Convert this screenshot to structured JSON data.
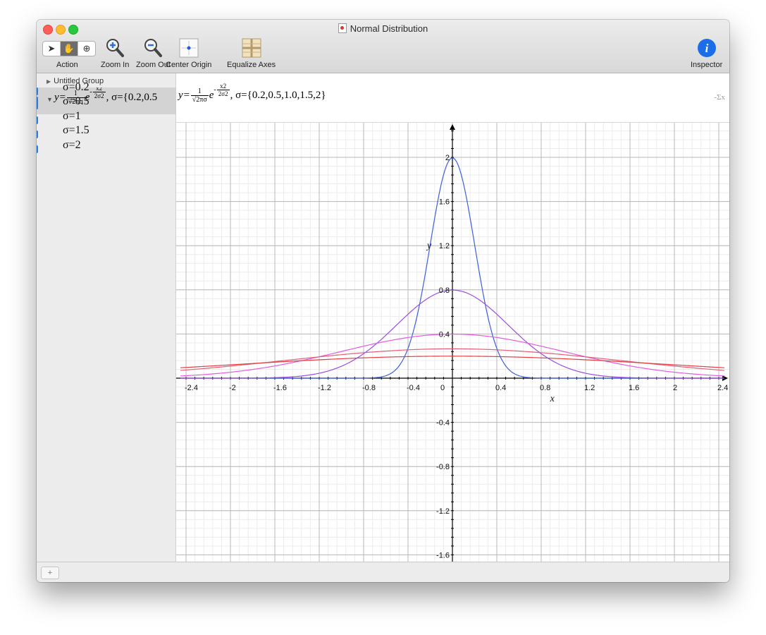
{
  "window": {
    "title": "Normal Distribution"
  },
  "toolbar": {
    "action_label": "Action",
    "zoom_in_label": "Zoom In",
    "zoom_out_label": "Zoom Out",
    "center_origin_label": "Center Origin",
    "equalize_axes_label": "Equalize Axes",
    "inspector_label": "Inspector"
  },
  "sidebar": {
    "group_label": "Untitled Group",
    "equation": {
      "lhs": "y=",
      "frac_num": "1",
      "frac_den": "√2πσ",
      "exp_base": "e",
      "exp_sign": "-",
      "exp_num": "x2",
      "exp_den": "2σ2",
      "params": ", σ={0.2,0.5"
    },
    "items": [
      {
        "label": "σ=0.2"
      },
      {
        "label": "σ=0.5"
      },
      {
        "label": "σ=1"
      },
      {
        "label": "σ=1.5"
      },
      {
        "label": "σ=2"
      }
    ]
  },
  "header_equation": {
    "lhs": "y=",
    "frac_num": "1",
    "frac_den": "√2πσ",
    "exp_base": "e",
    "exp_sign": "-",
    "exp_num": "x2",
    "exp_den": "2σ2",
    "params": ", σ={0.2,0.5,1.0,1.5,2}"
  },
  "colors": {
    "sigma_0_2": "#3b5fe0",
    "sigma_0_5": "#9b4fe0",
    "sigma_1": "#e35ce0",
    "sigma_1_5": "#e0607a",
    "sigma_2": "#e04040"
  },
  "chart_data": {
    "type": "line",
    "xlabel": "x",
    "ylabel": "y",
    "xlim": [
      -2.45,
      2.45
    ],
    "ylim": [
      -1.62,
      2.3
    ],
    "x_ticks": [
      -2.4,
      -2,
      -1.6,
      -1.2,
      -0.8,
      -0.4,
      0,
      0.4,
      0.8,
      1.2,
      1.6,
      2,
      2.4
    ],
    "y_ticks": [
      2,
      1.6,
      1.2,
      0.8,
      0.4,
      -0.4,
      -0.8,
      -1.2,
      -1.6
    ],
    "x_tick_labels": [
      "-2.4",
      "-2",
      "-1.6",
      "-1.2",
      "-0.8",
      "-0.4",
      "0",
      "0.4",
      "0.8",
      "1.2",
      "1.6",
      "2",
      "2.4"
    ],
    "y_tick_labels": [
      "2",
      "1.6",
      "1.2",
      "0.8",
      "0.4",
      "-0.4",
      "-0.8",
      "-1.2",
      "-1.6"
    ],
    "grid": true,
    "series": [
      {
        "name": "σ=0.2",
        "sigma": 0.2,
        "color": "#3b5fe0"
      },
      {
        "name": "σ=0.5",
        "sigma": 0.5,
        "color": "#9b4fe0"
      },
      {
        "name": "σ=1",
        "sigma": 1.0,
        "color": "#e35ce0"
      },
      {
        "name": "σ=1.5",
        "sigma": 1.5,
        "color": "#e0607a"
      },
      {
        "name": "σ=2",
        "sigma": 2.0,
        "color": "#e04040"
      }
    ]
  }
}
